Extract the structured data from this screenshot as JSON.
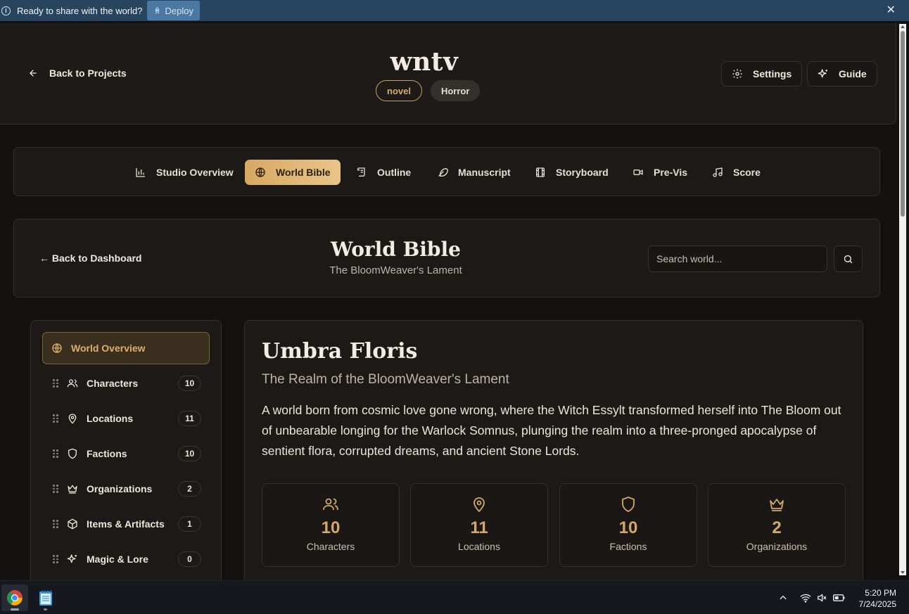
{
  "banner": {
    "message": "Ready to share with the world?",
    "deploy_label": "Deploy"
  },
  "header": {
    "back_label": "Back to Projects",
    "project_title": "wntv",
    "tags": [
      "novel",
      "Horror"
    ],
    "settings_label": "Settings",
    "guide_label": "Guide"
  },
  "tabs": [
    {
      "label": "Studio Overview",
      "icon": "bar-chart-icon"
    },
    {
      "label": "World Bible",
      "icon": "globe-icon",
      "active": true
    },
    {
      "label": "Outline",
      "icon": "scroll-icon"
    },
    {
      "label": "Manuscript",
      "icon": "feather-icon"
    },
    {
      "label": "Storyboard",
      "icon": "film-icon"
    },
    {
      "label": "Pre-Vis",
      "icon": "video-icon"
    },
    {
      "label": "Score",
      "icon": "music-icon"
    }
  ],
  "world_bible": {
    "back_label": "← Back to Dashboard",
    "title": "World Bible",
    "subtitle": "The BloomWeaver's Lament",
    "search_placeholder": "Search world..."
  },
  "sidebar": {
    "active_label": "World Overview",
    "items": [
      {
        "label": "Characters",
        "count": "10",
        "icon": "users-icon"
      },
      {
        "label": "Locations",
        "count": "11",
        "icon": "map-pin-icon"
      },
      {
        "label": "Factions",
        "count": "10",
        "icon": "shield-icon"
      },
      {
        "label": "Organizations",
        "count": "2",
        "icon": "crown-icon"
      },
      {
        "label": "Items & Artifacts",
        "count": "1",
        "icon": "box-icon"
      },
      {
        "label": "Magic & Lore",
        "count": "0",
        "icon": "sparkles-icon"
      }
    ]
  },
  "overview": {
    "name": "Umbra Floris",
    "subtitle": "The Realm of the BloomWeaver's Lament",
    "description": "A world born from cosmic love gone wrong, where the Witch Essylt transformed herself into The Bloom out of unbearable longing for the Warlock Somnus, plunging the realm into a three-pronged apocalypse of sentient flora, corrupted dreams, and ancient Stone Lords.",
    "stats": [
      {
        "value": "10",
        "label": "Characters",
        "icon": "users-icon"
      },
      {
        "value": "11",
        "label": "Locations",
        "icon": "map-pin-icon"
      },
      {
        "value": "10",
        "label": "Factions",
        "icon": "shield-icon"
      },
      {
        "value": "2",
        "label": "Organizations",
        "icon": "crown-icon"
      }
    ]
  },
  "taskbar": {
    "time": "5:20 PM",
    "date": "7/24/2025"
  },
  "colors": {
    "accent": "#d7a962",
    "banner": "#27455f",
    "background": "#141210"
  }
}
